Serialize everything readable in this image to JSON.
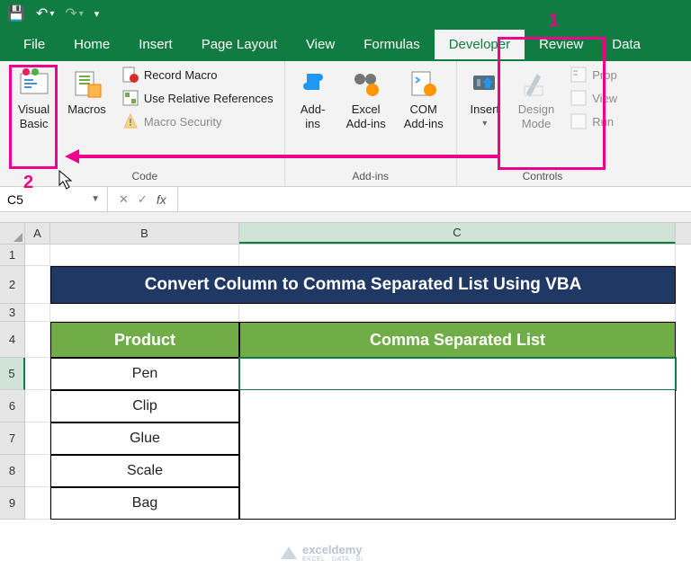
{
  "titlebar": {
    "save": "💾",
    "undo": "↶",
    "redo": "↷"
  },
  "tabs": {
    "file": "File",
    "home": "Home",
    "insert": "Insert",
    "pagelayout": "Page Layout",
    "view": "View",
    "formulas": "Formulas",
    "developer": "Developer",
    "review": "Review",
    "data": "Data"
  },
  "ribbon": {
    "code": {
      "visualbasic": "Visual\nBasic",
      "macros": "Macros",
      "record": "Record Macro",
      "relative": "Use Relative References",
      "security": "Macro Security",
      "label": "Code"
    },
    "addins": {
      "addins": "Add-\nins",
      "excel": "Excel\nAdd-ins",
      "com": "COM\nAdd-ins",
      "label": "Add-ins"
    },
    "controls": {
      "insert": "Insert",
      "design": "Design\nMode",
      "properties": "Properties",
      "viewcode": "View Code",
      "run": "Run Dialog",
      "label": "Controls"
    }
  },
  "namebox": "C5",
  "columns": {
    "A": "A",
    "B": "B",
    "C": "C"
  },
  "rows": [
    "1",
    "2",
    "3",
    "4",
    "5",
    "6",
    "7",
    "8",
    "9"
  ],
  "sheet": {
    "title": "Convert Column to Comma Separated List Using VBA",
    "h1": "Product",
    "h2": "Comma Separated List",
    "products": [
      "Pen",
      "Clip",
      "Glue",
      "Scale",
      "Bag"
    ]
  },
  "annotations": {
    "n1": "1",
    "n2": "2"
  },
  "watermark": {
    "name": "exceldemy",
    "sub": "EXCEL · DATA · BI"
  }
}
